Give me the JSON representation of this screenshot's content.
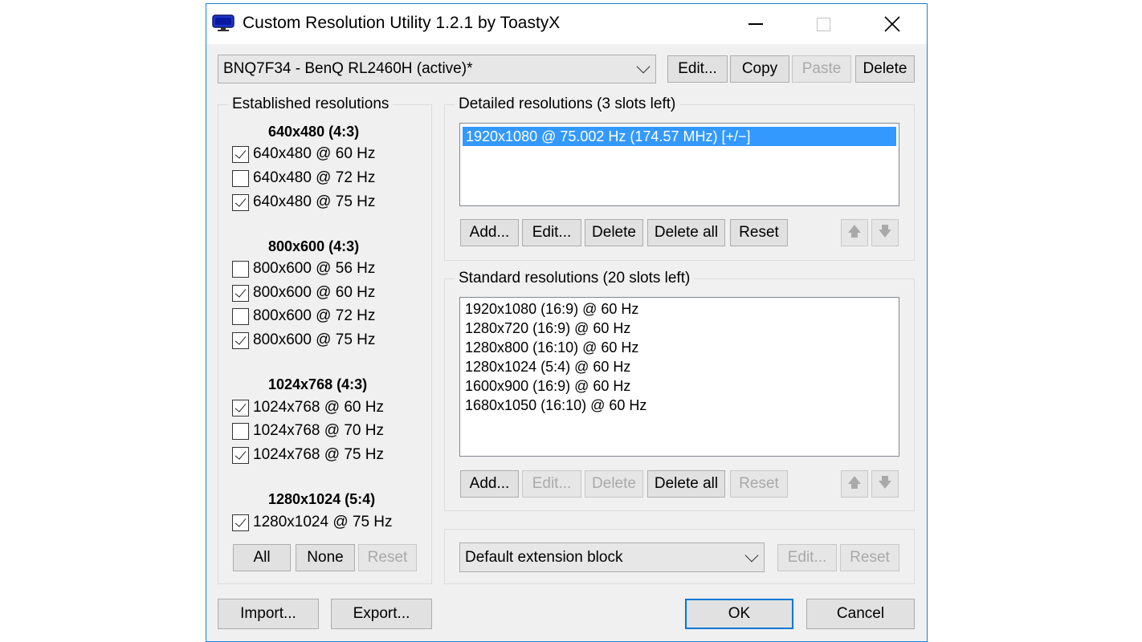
{
  "window": {
    "title": "Custom Resolution Utility 1.2.1 by ToastyX"
  },
  "monitor_select": {
    "value": "BNQ7F34 - BenQ RL2460H (active)*"
  },
  "top_buttons": {
    "edit": "Edit...",
    "copy": "Copy",
    "paste": "Paste",
    "delete": "Delete"
  },
  "established": {
    "label": "Established resolutions",
    "groups": [
      {
        "heading": "640x480 (4:3)",
        "items": [
          {
            "label": "640x480 @ 60 Hz",
            "checked": true
          },
          {
            "label": "640x480 @ 72 Hz",
            "checked": false
          },
          {
            "label": "640x480 @ 75 Hz",
            "checked": true
          }
        ]
      },
      {
        "heading": "800x600 (4:3)",
        "items": [
          {
            "label": "800x600 @ 56 Hz",
            "checked": false
          },
          {
            "label": "800x600 @ 60 Hz",
            "checked": true
          },
          {
            "label": "800x600 @ 72 Hz",
            "checked": false
          },
          {
            "label": "800x600 @ 75 Hz",
            "checked": true
          }
        ]
      },
      {
        "heading": "1024x768 (4:3)",
        "items": [
          {
            "label": "1024x768 @ 60 Hz",
            "checked": true
          },
          {
            "label": "1024x768 @ 70 Hz",
            "checked": false
          },
          {
            "label": "1024x768 @ 75 Hz",
            "checked": true
          }
        ]
      },
      {
        "heading": "1280x1024 (5:4)",
        "items": [
          {
            "label": "1280x1024 @ 75 Hz",
            "checked": true
          }
        ]
      }
    ],
    "buttons": {
      "all": "All",
      "none": "None",
      "reset": "Reset"
    }
  },
  "detailed": {
    "label": "Detailed resolutions (3 slots left)",
    "items": [
      "1920x1080 @ 75.002 Hz (174.57 MHz) [+/−]"
    ],
    "buttons": {
      "add": "Add...",
      "edit": "Edit...",
      "delete": "Delete",
      "delete_all": "Delete all",
      "reset": "Reset"
    }
  },
  "standard": {
    "label": "Standard resolutions (20 slots left)",
    "items": [
      "1920x1080 (16:9) @ 60 Hz",
      "1280x720 (16:9) @ 60 Hz",
      "1280x800 (16:10) @ 60 Hz",
      "1280x1024 (5:4) @ 60 Hz",
      "1600x900 (16:9) @ 60 Hz",
      "1680x1050 (16:10) @ 60 Hz"
    ],
    "buttons": {
      "add": "Add...",
      "edit": "Edit...",
      "delete": "Delete",
      "delete_all": "Delete all",
      "reset": "Reset"
    }
  },
  "extension": {
    "value": "Default extension block",
    "edit": "Edit...",
    "reset": "Reset"
  },
  "footer": {
    "import": "Import...",
    "export": "Export...",
    "ok": "OK",
    "cancel": "Cancel"
  },
  "icons": {
    "up": "arrow-up-icon",
    "down": "arrow-down-icon"
  },
  "colors": {
    "window_border": "#1883d7",
    "selection": "#3399ff",
    "default_button_border": "#0078d7"
  }
}
